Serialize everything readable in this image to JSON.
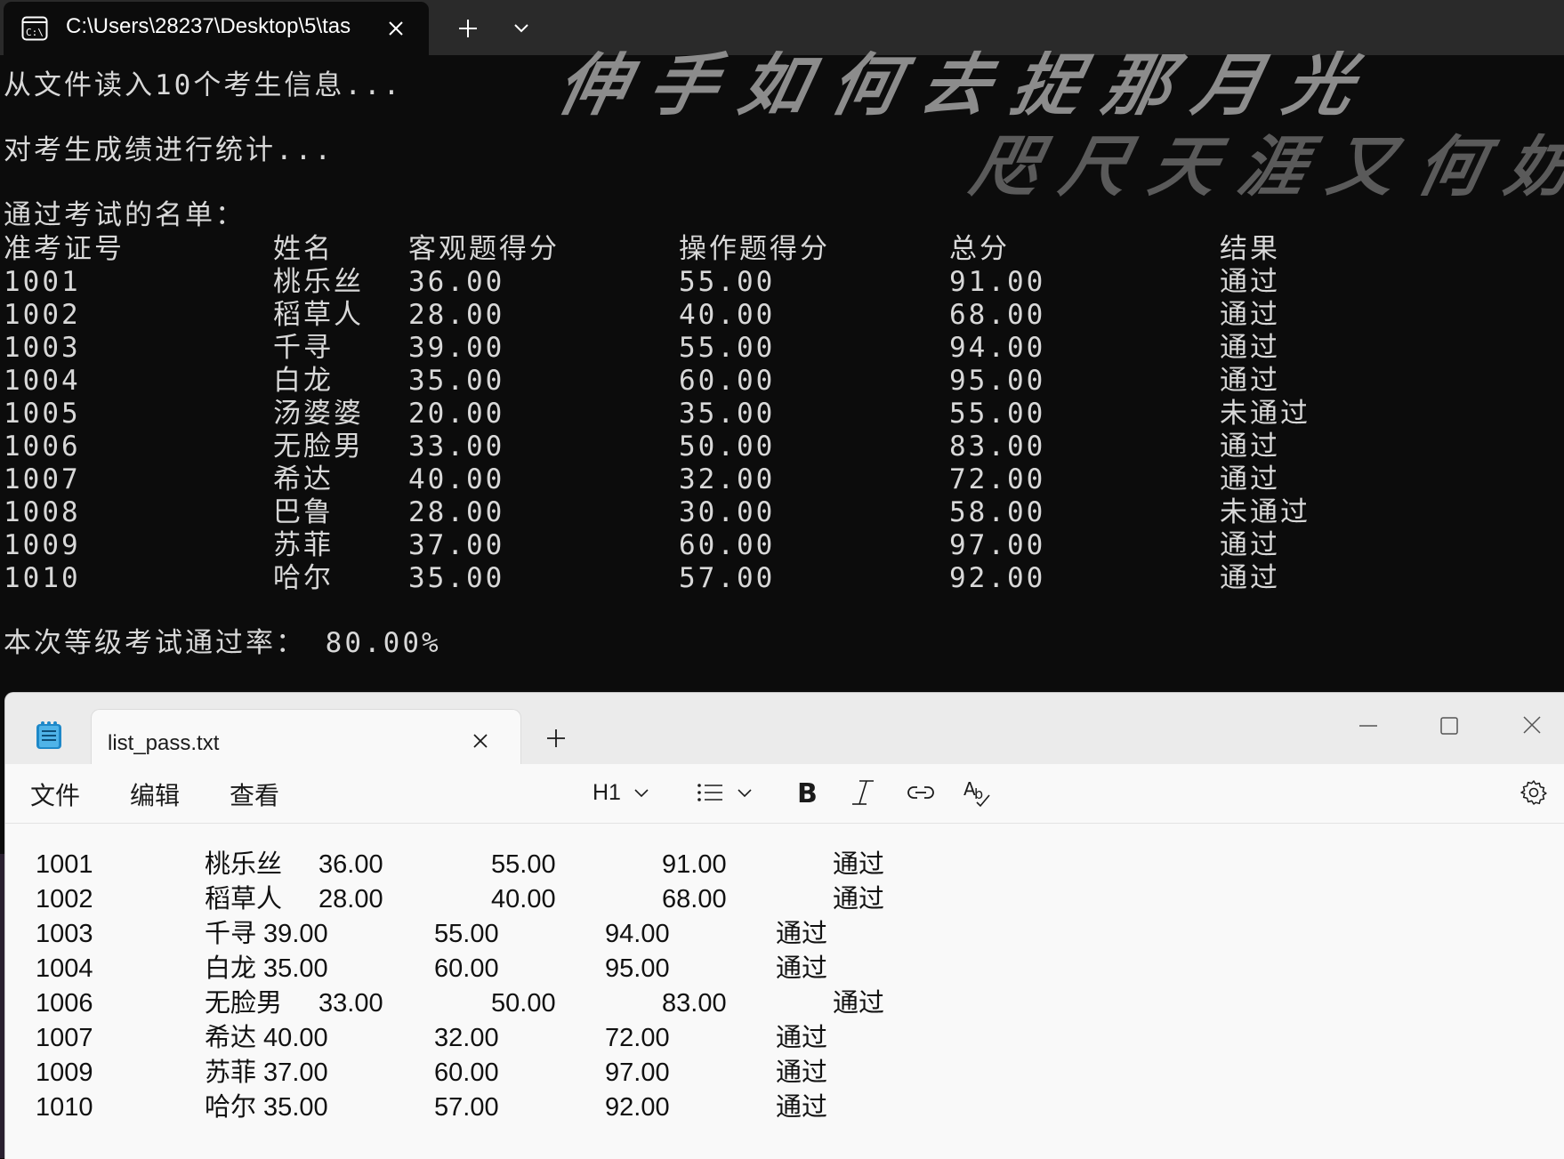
{
  "terminal": {
    "tab_title": "C:\\Users\\28237\\Desktop\\5\\tas",
    "lines": {
      "reading": "从文件读入10个考生信息...",
      "stats": "对考生成绩进行统计...",
      "pass_list_title": "通过考试的名单："
    },
    "headers": [
      "准考证号",
      "姓名",
      "客观题得分",
      "操作题得分",
      "总分",
      "结果"
    ],
    "rows": [
      [
        "1001",
        "桃乐丝",
        "36.00",
        "55.00",
        "91.00",
        "通过"
      ],
      [
        "1002",
        "稻草人",
        "28.00",
        "40.00",
        "68.00",
        "通过"
      ],
      [
        "1003",
        "千寻",
        "39.00",
        "55.00",
        "94.00",
        "通过"
      ],
      [
        "1004",
        "白龙",
        "35.00",
        "60.00",
        "95.00",
        "通过"
      ],
      [
        "1005",
        "汤婆婆",
        "20.00",
        "35.00",
        "55.00",
        "未通过"
      ],
      [
        "1006",
        "无脸男",
        "33.00",
        "50.00",
        "83.00",
        "通过"
      ],
      [
        "1007",
        "希达",
        "40.00",
        "32.00",
        "72.00",
        "通过"
      ],
      [
        "1008",
        "巴鲁",
        "28.00",
        "30.00",
        "58.00",
        "未通过"
      ],
      [
        "1009",
        "苏菲",
        "37.00",
        "60.00",
        "97.00",
        "通过"
      ],
      [
        "1010",
        "哈尔",
        "35.00",
        "57.00",
        "92.00",
        "通过"
      ]
    ],
    "pass_rate_text": "本次等级考试通过率： 80.00%",
    "wallpaper_text_1": "伸手如何去捉那月光",
    "wallpaper_text_2": "咫尺天涯又何妨"
  },
  "notepad": {
    "tab_title": "list_pass.txt",
    "menu": [
      "文件",
      "编辑",
      "查看"
    ],
    "heading_selector": "H1",
    "rows": [
      {
        "cells": [
          "1001",
          "桃乐丝",
          "36.00",
          "55.00",
          "91.00",
          "通过"
        ],
        "layout": "wide"
      },
      {
        "cells": [
          "1002",
          "稻草人",
          "28.00",
          "40.00",
          "68.00",
          "通过"
        ],
        "layout": "wide"
      },
      {
        "cells": [
          "1003",
          "千寻 39.00",
          "55.00",
          "94.00",
          "通过"
        ],
        "layout": "narrow"
      },
      {
        "cells": [
          "1004",
          "白龙 35.00",
          "60.00",
          "95.00",
          "通过"
        ],
        "layout": "narrow"
      },
      {
        "cells": [
          "1006",
          "无脸男",
          "33.00",
          "50.00",
          "83.00",
          "通过"
        ],
        "layout": "wide"
      },
      {
        "cells": [
          "1007",
          "希达 40.00",
          "32.00",
          "72.00",
          "通过"
        ],
        "layout": "narrow"
      },
      {
        "cells": [
          "1009",
          "苏菲 37.00",
          "60.00",
          "97.00",
          "通过"
        ],
        "layout": "narrow"
      },
      {
        "cells": [
          "1010",
          "哈尔 35.00",
          "57.00",
          "92.00",
          "通过"
        ],
        "layout": "narrow"
      }
    ]
  }
}
